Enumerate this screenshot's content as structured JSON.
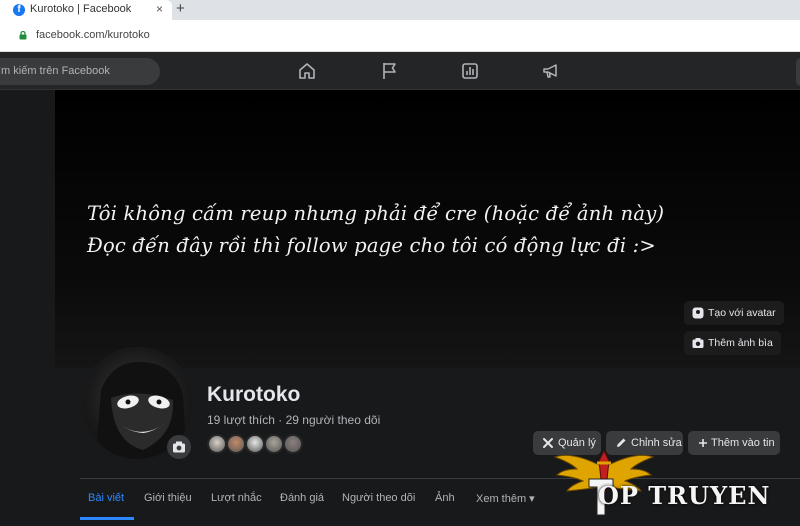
{
  "browser": {
    "tab_title": "Kurotoko | Facebook",
    "close_glyph": "×",
    "new_tab_glyph": "+",
    "favicon_letter": "f",
    "url": "facebook.com/kurotoko"
  },
  "fb_nav": {
    "search_placeholder": "ìm kiếm trên Facebook",
    "icons": [
      "home-icon",
      "flag-icon",
      "chart-icon",
      "megaphone-icon"
    ]
  },
  "cover": {
    "line1": "Tôi không cấm reup nhưng phải để cre (hoặc để ảnh này)",
    "line2": "Đọc đến đây rồi thì follow page cho tôi có động lực đi :>",
    "avatar_button": "Tạo với avatar",
    "cover_photo_button": "Thêm ảnh bìa"
  },
  "profile": {
    "name": "Kurotoko",
    "stats": "19 lượt thích · 29 người theo dõi",
    "friend_colors": [
      "#d8d0c8",
      "#c48a6a",
      "#e5e5e5",
      "#a9a39a",
      "#8a7f7c"
    ]
  },
  "actions": {
    "manage": "Quản lý",
    "edit": "Chỉnh sửa",
    "add_story": "Thêm vào tin"
  },
  "tabs": [
    "Bài viết",
    "Giới thiệu",
    "Lượt nhắc",
    "Đánh giá",
    "Người theo dõi",
    "Ảnh",
    "Xem thêm ▾"
  ],
  "watermark": {
    "text": "OP TRUYEN"
  },
  "colors": {
    "accent": "#2d88ff",
    "fb_blue": "#1877f2",
    "background": "#18191a",
    "surface": "#242526",
    "button": "#3a3b3c",
    "watermark_gold": "#e0a400",
    "watermark_red": "#c0201e"
  }
}
